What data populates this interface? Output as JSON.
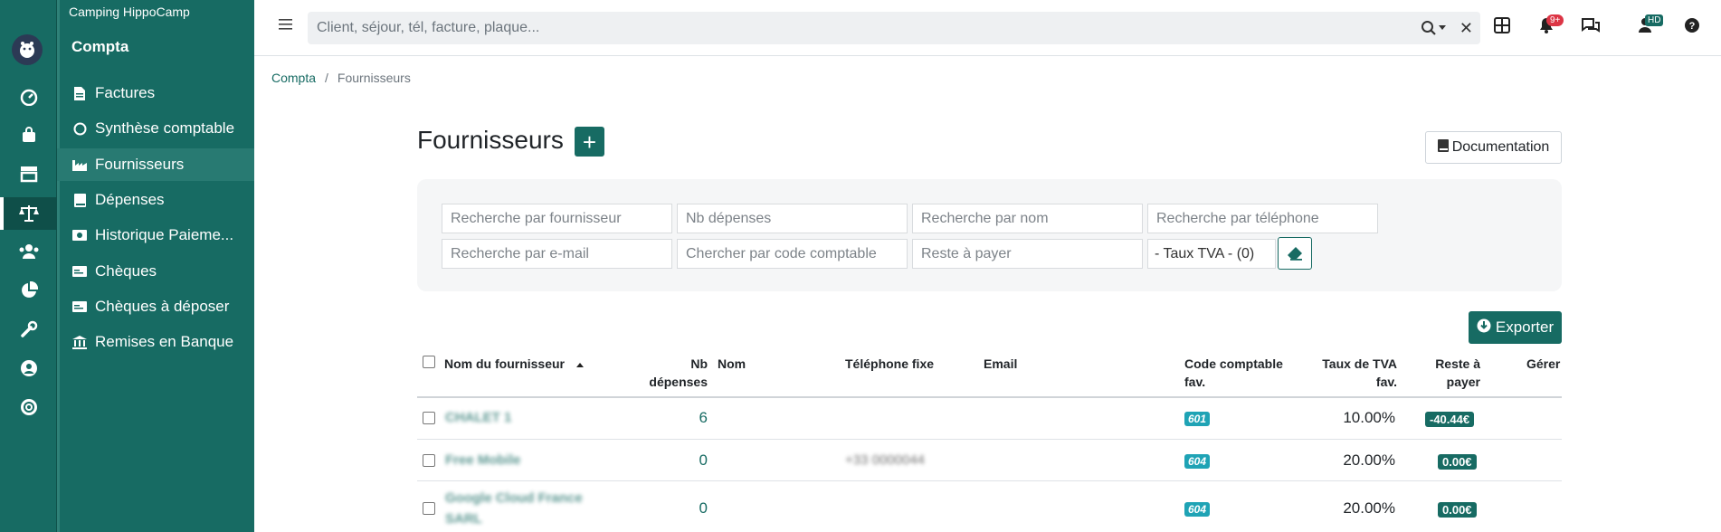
{
  "app": {
    "camping_name": "Camping HippoCamp",
    "section": "Compta"
  },
  "rail_icons": [
    "dashboard-icon",
    "bag-icon",
    "store-icon",
    "balance-icon",
    "users-icon",
    "pie-chart-icon",
    "wrench-icon",
    "user-circle-icon",
    "lifebuoy-icon"
  ],
  "sidebar": {
    "items": [
      {
        "label": "Factures",
        "icon": "file-icon"
      },
      {
        "label": "Synthèse comptable",
        "icon": "circle-icon"
      },
      {
        "label": "Fournisseurs",
        "icon": "industry-icon",
        "active": true
      },
      {
        "label": "Dépenses",
        "icon": "book-icon"
      },
      {
        "label": "Historique Paieme...",
        "icon": "money-icon"
      },
      {
        "label": "Chèques",
        "icon": "cheque-icon"
      },
      {
        "label": "Chèques à déposer",
        "icon": "cheque-icon"
      },
      {
        "label": "Remises en Banque",
        "icon": "bank-icon"
      }
    ]
  },
  "topbar": {
    "search_placeholder": "Client, séjour, tél, facture, plaque...",
    "notif_badge": "9+",
    "user_initials": "HD"
  },
  "breadcrumb": {
    "root": "Compta",
    "current": "Fournisseurs"
  },
  "page": {
    "title": "Fournisseurs",
    "add_label": "+",
    "doc_label": "Documentation",
    "export_label": "Exporter"
  },
  "filters": {
    "supplier": "Recherche par fournisseur",
    "nb_expenses": "Nb dépenses",
    "name": "Recherche par nom",
    "phone": "Recherche par téléphone",
    "email": "Recherche par e-mail",
    "code": "Chercher par code comptable",
    "due": "Reste à payer",
    "tva_select": "- Taux TVA - (0)"
  },
  "table": {
    "headers": {
      "supplier": "Nom du fournisseur",
      "nb_line1": "Nb",
      "nb_line2": "dépenses",
      "name": "Nom",
      "phone": "Téléphone fixe",
      "email": "Email",
      "code_line1": "Code comptable",
      "code_line2": "fav.",
      "tva_line1": "Taux de TVA",
      "tva_line2": "fav.",
      "due_line1": "Reste à",
      "due_line2": "payer",
      "manage": "Gérer"
    },
    "rows": [
      {
        "supplier": "CHALET 1",
        "nb": "6",
        "phone": "",
        "code": "601",
        "tva": "10.00%",
        "due": "-40.44€"
      },
      {
        "supplier": "Free Mobile",
        "nb": "0",
        "phone": "+33 0000044",
        "code": "604",
        "tva": "20.00%",
        "due": "0.00€"
      },
      {
        "supplier": "Google Cloud France",
        "supplier_line2": "SARL",
        "nb": "0",
        "phone": "",
        "code": "604",
        "tva": "20.00%",
        "due": "0.00€"
      }
    ]
  },
  "colors": {
    "primary": "#176b63",
    "badge_code": "#1fa3b5",
    "notif": "#dc3545"
  }
}
